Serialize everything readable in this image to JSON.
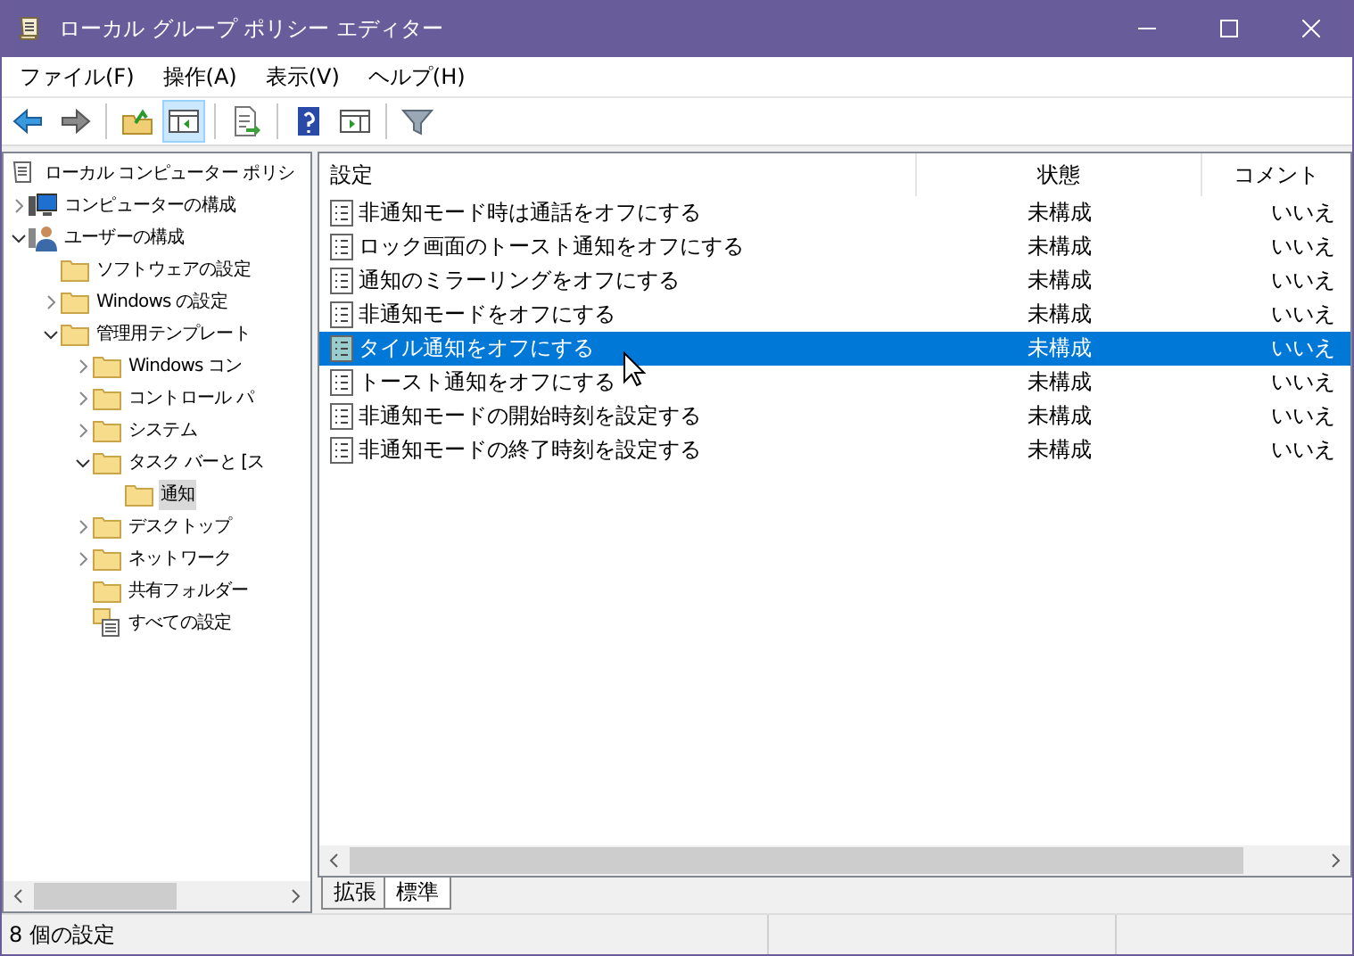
{
  "window": {
    "title": "ローカル グループ ポリシー エディター"
  },
  "menu": [
    "ファイル(F)",
    "操作(A)",
    "表示(V)",
    "ヘルプ(H)"
  ],
  "toolbar": [
    {
      "kind": "back",
      "pressed": false
    },
    {
      "kind": "forward",
      "pressed": false
    },
    {
      "kind": "separator"
    },
    {
      "kind": "up",
      "pressed": false
    },
    {
      "kind": "tree",
      "pressed": true
    },
    {
      "kind": "separator"
    },
    {
      "kind": "export",
      "pressed": false
    },
    {
      "kind": "separator"
    },
    {
      "kind": "help",
      "pressed": false
    },
    {
      "kind": "pane",
      "pressed": false
    },
    {
      "kind": "separator"
    },
    {
      "kind": "filter",
      "pressed": false
    }
  ],
  "tree": [
    {
      "label": "ローカル コンピューター ポリシ",
      "kind": "policy",
      "selected": false,
      "children": [
        {
          "label": "コンピューターの構成",
          "kind": "computer",
          "expanded": false,
          "selected": false
        },
        {
          "label": "ユーザーの構成",
          "kind": "user",
          "expanded": true,
          "selected": false,
          "children": [
            {
              "label": "ソフトウェアの設定",
              "kind": "folder",
              "selected": false
            },
            {
              "label": "Windows の設定",
              "kind": "folder",
              "expanded": false,
              "selected": false
            },
            {
              "label": "管理用テンプレート",
              "kind": "folder",
              "expanded": true,
              "selected": false,
              "children": [
                {
                  "label": "Windows コン",
                  "kind": "folder",
                  "expanded": false,
                  "selected": false
                },
                {
                  "label": "コントロール パ",
                  "kind": "folder",
                  "expanded": false,
                  "selected": false
                },
                {
                  "label": "システム",
                  "kind": "folder",
                  "expanded": false,
                  "selected": false
                },
                {
                  "label": "タスク バーと [ス",
                  "kind": "folder",
                  "expanded": true,
                  "selected": false,
                  "children": [
                    {
                      "label": "通知",
                      "kind": "folder",
                      "selected": true
                    }
                  ]
                },
                {
                  "label": "デスクトップ",
                  "kind": "folder",
                  "expanded": false,
                  "selected": false
                },
                {
                  "label": "ネットワーク",
                  "kind": "folder",
                  "expanded": false,
                  "selected": false
                },
                {
                  "label": "共有フォルダー",
                  "kind": "folder",
                  "selected": false
                },
                {
                  "label": "すべての設定",
                  "kind": "all",
                  "selected": false
                }
              ]
            }
          ]
        }
      ]
    }
  ],
  "table": {
    "columns": [
      "設定",
      "状態",
      "コメント"
    ],
    "rows": [
      {
        "name": "非通知モード時は通話をオフにする",
        "state": "未構成",
        "comment": "いいえ",
        "selected": false
      },
      {
        "name": "ロック画面のトースト通知をオフにする",
        "state": "未構成",
        "comment": "いいえ",
        "selected": false
      },
      {
        "name": "通知のミラーリングをオフにする",
        "state": "未構成",
        "comment": "いいえ",
        "selected": false
      },
      {
        "name": "非通知モードをオフにする",
        "state": "未構成",
        "comment": "いいえ",
        "selected": false
      },
      {
        "name": "タイル通知をオフにする",
        "state": "未構成",
        "comment": "いいえ",
        "selected": true
      },
      {
        "name": "トースト通知をオフにする",
        "state": "未構成",
        "comment": "いいえ",
        "selected": false
      },
      {
        "name": "非通知モードの開始時刻を設定する",
        "state": "未構成",
        "comment": "いいえ",
        "selected": false
      },
      {
        "name": "非通知モードの終了時刻を設定する",
        "state": "未構成",
        "comment": "いいえ",
        "selected": false
      }
    ]
  },
  "tabs": [
    {
      "label": "拡張",
      "selected": false
    },
    {
      "label": "標準",
      "selected": true
    }
  ],
  "status_bar": "8 個の設定"
}
